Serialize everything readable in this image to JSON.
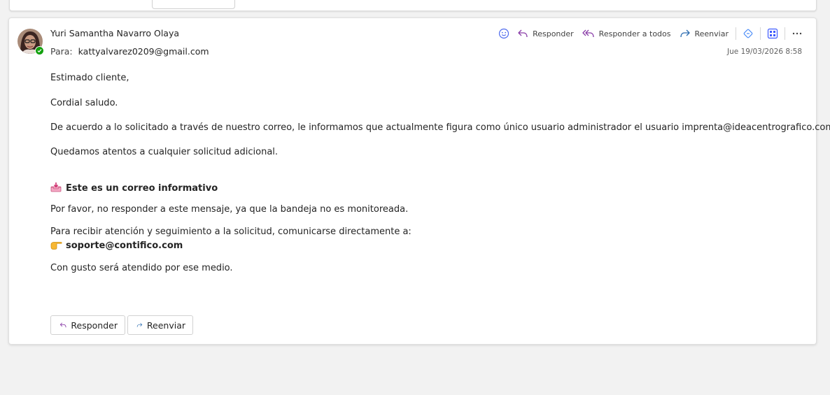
{
  "message": {
    "sender_name": "Yuri Samantha Navarro Olaya",
    "to_label": "Para:",
    "to_value": "kattyalvarez0209@gmail.com",
    "date": "Jue 19/03/2026 8:58"
  },
  "toolbar": {
    "reply_label": "Responder",
    "reply_all_label": "Responder a todos",
    "forward_label": "Reenviar"
  },
  "body": {
    "greeting": "Estimado cliente,",
    "salutation": "Cordial saludo.",
    "paragraph_1": "De acuerdo a lo solicitado a través de nuestro correo, le informamos que actualmente figura como único usuario administrador el usuario  imprenta@ideacentrografico.com",
    "paragraph_2": "Quedamos atentos a cualquier solicitud adicional.",
    "notice_title": "Este es un correo informativo",
    "notice_text": "Por favor, no responder a este mensaje, ya que la bandeja no es monitoreada.",
    "support_text": "Para recibir atención y seguimiento a la solicitud, comunicarse directamente a:",
    "support_email": "soporte@contifico.com",
    "closing": "Con gusto será atendido por ese medio."
  },
  "footer_buttons": {
    "reply_label": "Responder",
    "forward_label": "Reenviar"
  },
  "colors": {
    "reply_arrow": "#8a3ea8",
    "forward_arrow": "#2b6cb0",
    "accent_blue": "#4f6bed",
    "presence": "#13a10e"
  }
}
